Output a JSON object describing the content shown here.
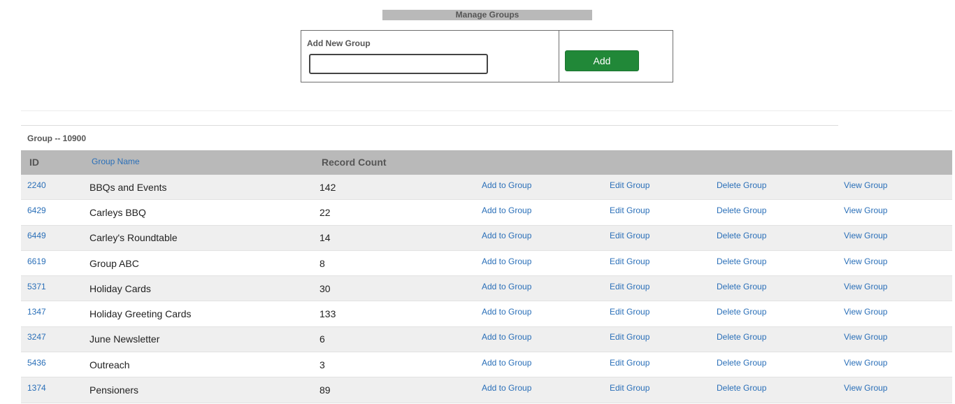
{
  "header": {
    "title": "Manage Groups"
  },
  "add_group": {
    "label": "Add New Group",
    "input_value": "",
    "placeholder": "",
    "button_label": "Add"
  },
  "group_caption": "Group -- 10900",
  "table": {
    "headers": {
      "id": "ID",
      "name": "Group Name",
      "count": "Record Count"
    },
    "action_labels": {
      "add": "Add to Group",
      "edit": "Edit Group",
      "delete": "Delete Group",
      "view": "View Group"
    },
    "rows": [
      {
        "id": "2240",
        "name": "BBQs and Events",
        "count": "142"
      },
      {
        "id": "6429",
        "name": "Carleys BBQ",
        "count": "22"
      },
      {
        "id": "6449",
        "name": "Carley's Roundtable",
        "count": "14"
      },
      {
        "id": "6619",
        "name": "Group ABC",
        "count": "8"
      },
      {
        "id": "5371",
        "name": "Holiday Cards",
        "count": "30"
      },
      {
        "id": "1347",
        "name": "Holiday Greeting Cards",
        "count": "133"
      },
      {
        "id": "3247",
        "name": "June Newsletter",
        "count": "6"
      },
      {
        "id": "5436",
        "name": "Outreach",
        "count": "3"
      },
      {
        "id": "1374",
        "name": "Pensioners",
        "count": "89"
      }
    ]
  },
  "colors": {
    "header_bg": "#b9b9b9",
    "link": "#2a6fb8",
    "add_button": "#218838",
    "row_alt": "#efefef"
  }
}
